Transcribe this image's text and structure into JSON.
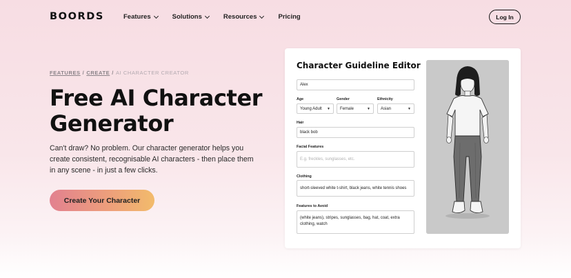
{
  "nav": {
    "logo": "BOORDS",
    "links": [
      "Features",
      "Solutions",
      "Resources",
      "Pricing"
    ],
    "login": "Log In"
  },
  "hero": {
    "breadcrumb": [
      "FEATURES",
      "CREATE",
      "AI CHARACTER CREATOR"
    ],
    "breadcrumb_sep": "/",
    "title_line1": "Free AI Character",
    "title_line2": "Generator",
    "description": "Can't draw? No problem. Our character generator helps you create consistent, recognisable AI characters - then place them in any scene - in just a few clicks.",
    "cta": "Create Your Character"
  },
  "editor": {
    "title": "Character Guideline Editor",
    "name_value": "Alex",
    "age_label": "Age",
    "age_value": "Young Adult",
    "gender_label": "Gender",
    "gender_value": "Female",
    "ethnicity_label": "Ethnicity",
    "ethnicity_value": "Asian",
    "hair_label": "Hair",
    "hair_value": "black bob",
    "facial_label": "Facial Features",
    "facial_placeholder": "E.g. freckles, sunglasses, etc.",
    "clothing_label": "Clothing",
    "clothing_value": "short-sleeved white t-shirt, black jeans, white tennis shoes",
    "avoid_label": "Features to Avoid",
    "avoid_value": "(white jeans), stripes, sunglasses, bag, hat, coat, extra clothing, watch",
    "dropdown_arrow": "▼"
  },
  "colors": {
    "bg_top": "#f7dde3",
    "cta_start": "#e2818f",
    "cta_end": "#f2bb6b"
  },
  "icons": [
    "chevron-down-icon",
    "dropdown-arrow-icon"
  ]
}
